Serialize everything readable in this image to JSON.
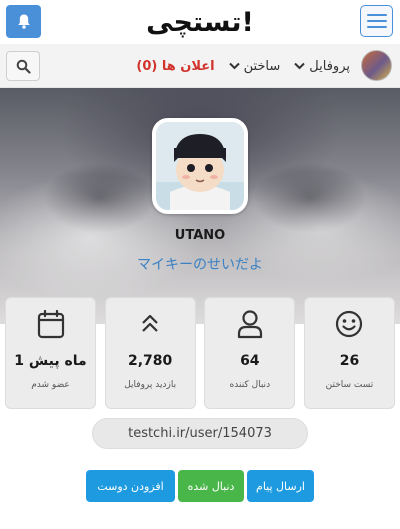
{
  "header": {
    "logo_text": "تستچی!",
    "bell_icon": "bell-icon",
    "menu_icon": "hamburger-menu-icon"
  },
  "nav": {
    "items": [
      {
        "label": "پروفایل",
        "icon": "chevron-down-icon"
      },
      {
        "label": "ساختن",
        "icon": "chevron-down-icon"
      },
      {
        "label": "اعلان ها (0)"
      }
    ],
    "search_icon": "search-icon"
  },
  "profile": {
    "username": "UTANO",
    "subtitle": "マイキーのせいだよ"
  },
  "stats": [
    {
      "icon": "smile-icon",
      "value": "26",
      "label": "تست ساختن"
    },
    {
      "icon": "user-icon",
      "value": "64",
      "label": "دنبال کننده"
    },
    {
      "icon": "double-chevron-up-icon",
      "value": "2,780",
      "label": "بازدید پروفایل"
    },
    {
      "icon": "calendar-icon",
      "value": "1 ماه پیش",
      "label": "عضو شدم"
    }
  ],
  "profile_url": "testchi.ir/user/154073",
  "actions": {
    "send_message": "ارسال پیام",
    "followed": "دنبال شده",
    "add_friend": "افزودن دوست"
  },
  "colors": {
    "primary_blue": "#1e9be0",
    "green": "#49b649",
    "red": "#d0342c",
    "link_blue": "#3b82c4"
  }
}
